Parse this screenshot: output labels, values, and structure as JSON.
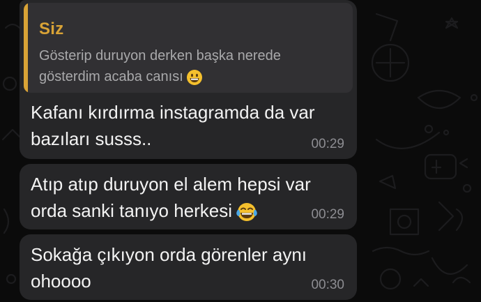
{
  "chat": {
    "messages": [
      {
        "reply": {
          "author": "Siz",
          "text": "Gösterip duruyon derken başka nerede gösterdim acaba canısı",
          "emoji": "grinning-face-emoji"
        },
        "text": "Kafanı kırdırma instagramda da var bazıları susss..",
        "time": "00:29"
      },
      {
        "text": "Atıp atıp duruyon el alem hepsi var orda sanki tanıyo herkesi",
        "emoji": "tears-of-joy-emoji",
        "time": "00:29"
      },
      {
        "text": "Sokağa çıkıyon orda görenler aynı ohoooo",
        "time": "00:30"
      }
    ]
  },
  "colors": {
    "background": "#0b0b0b",
    "bubble": "#262628",
    "quote_background": "#313033",
    "accent": "#d9a336",
    "timestamp": "#8d8d92"
  }
}
